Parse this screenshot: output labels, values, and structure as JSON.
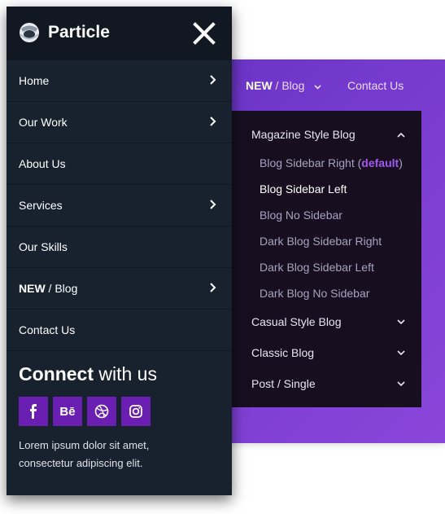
{
  "brand": {
    "name": "Particle"
  },
  "offcanvas": {
    "menu": [
      {
        "label": "Home",
        "has_children": true
      },
      {
        "label": "Our Work",
        "has_children": true
      },
      {
        "label": "About Us",
        "has_children": false
      },
      {
        "label": "Services",
        "has_children": true
      },
      {
        "label": "Our Skills",
        "has_children": false
      },
      {
        "label_bold": "NEW",
        "label_rest": " / Blog",
        "has_children": true
      },
      {
        "label": "Contact Us",
        "has_children": false
      }
    ],
    "connect": {
      "bold": "Connect",
      "rest": " with us"
    },
    "socials": [
      "facebook-icon",
      "behance-icon",
      "dribbble-icon",
      "instagram-icon"
    ],
    "social_glyphs": [
      "f",
      "Bē",
      "",
      ""
    ],
    "blurb": "Lorem ipsum dolor sit amet, consectetur adipiscing elit."
  },
  "top_nav": {
    "blog_bold": "NEW",
    "blog_rest": " / Blog",
    "contact": "Contact Us"
  },
  "dropdown": {
    "sections": [
      {
        "label": "Magazine Style Blog",
        "expanded": true
      },
      {
        "label": "Casual Style Blog",
        "expanded": false
      },
      {
        "label": "Classic Blog",
        "expanded": false
      },
      {
        "label": "Post / Single",
        "expanded": false
      }
    ],
    "magazine_children": [
      {
        "label": "Blog Sidebar Right (",
        "highlight": "default",
        "suffix": ")"
      },
      {
        "label": "Blog Sidebar Left",
        "active": true
      },
      {
        "label": "Blog No Sidebar"
      },
      {
        "label": "Dark Blog Sidebar Right"
      },
      {
        "label": "Dark Blog Sidebar Left"
      },
      {
        "label": "Dark Blog No Sidebar"
      }
    ]
  },
  "colors": {
    "accent_purple": "#6a1fb2",
    "highlight": "#a259f0",
    "panel_bg": "#18222e",
    "header_bg": "#111821",
    "dropdown_bg": "#170f20"
  }
}
